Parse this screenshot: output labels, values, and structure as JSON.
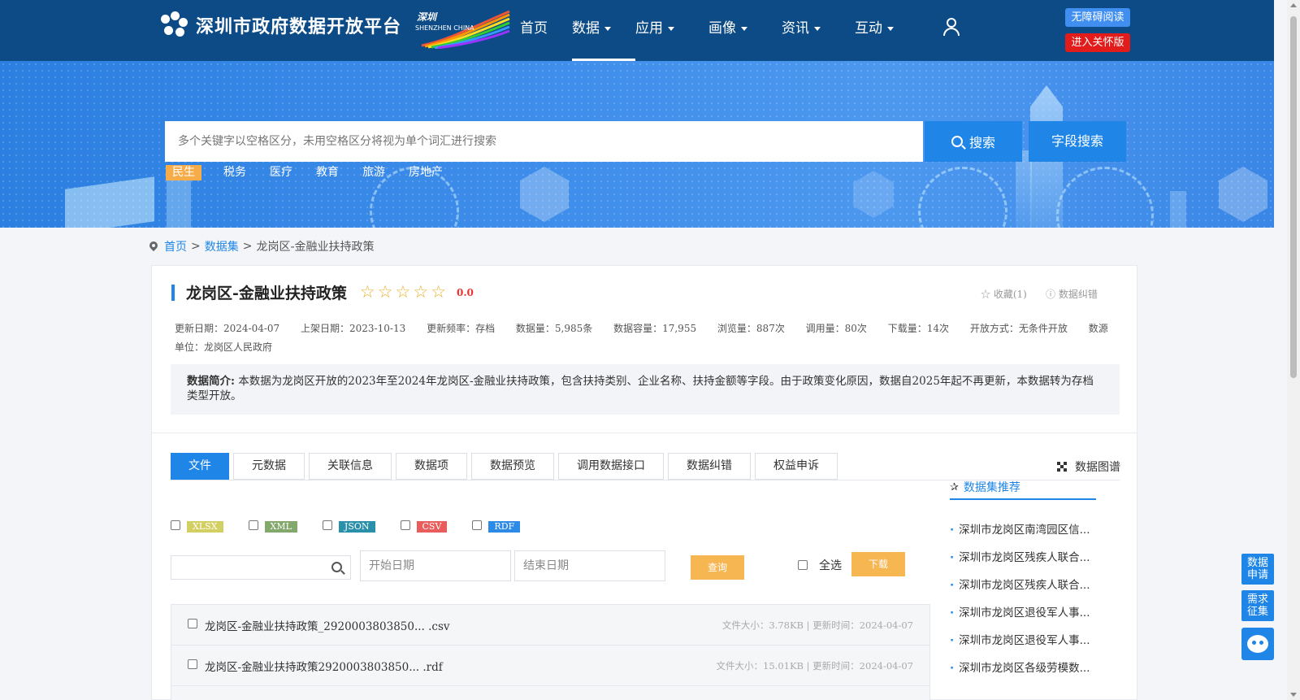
{
  "header": {
    "site_title": "深圳市政府数据开放平台",
    "badge_line1": "深圳",
    "badge_line2": "SHENZHEN CHINA",
    "nav": [
      {
        "label": "首页",
        "caret": false
      },
      {
        "label": "数据",
        "caret": true
      },
      {
        "label": "应用",
        "caret": true
      },
      {
        "label": "画像",
        "caret": true
      },
      {
        "label": "资讯",
        "caret": true
      },
      {
        "label": "互动",
        "caret": true
      }
    ],
    "accessibility_label": "无障碍阅读",
    "care_label": "进入关怀版"
  },
  "search": {
    "placeholder": "多个关键字以空格区分，未用空格区分将视为单个词汇进行搜索",
    "search_label": "搜索",
    "field_search_label": "字段搜索",
    "hot_tags": [
      "民生",
      "税务",
      "医疗",
      "教育",
      "旅游",
      "房地产"
    ]
  },
  "breadcrumb": {
    "home": "首页",
    "datasets": "数据集",
    "current": "龙岗区-金融业扶持政策",
    "sep": ">"
  },
  "dataset": {
    "title": "龙岗区-金融业扶持政策",
    "rating": "0.0",
    "stars": 5,
    "favorite": "收藏(1)",
    "correction": "数据纠错",
    "meta": [
      "更新日期：2024-04-07",
      "上架日期：2023-10-13",
      "更新频率：存档",
      "数据量：5,985条",
      "数据容量：17,955",
      "浏览量：887次",
      "调用量：80次",
      "下载量：14次",
      "开放方式：无条件开放",
      "数源单位：龙岗区人民政府"
    ],
    "intro_label": "数据简介:",
    "intro_text": " 本数据为龙岗区开放的2023年至2024年龙岗区-金融业扶持政策，包含扶持类别、企业名称、扶持金额等字段。由于政策变化原因，数据自2025年起不再更新，本数据转为存档类型开放。"
  },
  "tabs": [
    "文件",
    "元数据",
    "关联信息",
    "数据项",
    "数据预览",
    "调用数据接口",
    "数据纠错",
    "权益申诉"
  ],
  "graph_link": "数据图谱",
  "formats": [
    {
      "label": "XLSX",
      "color": "#d4cf62"
    },
    {
      "label": "XML",
      "color": "#83a86b"
    },
    {
      "label": "JSON",
      "color": "#2a8fa8"
    },
    {
      "label": "CSV",
      "color": "#ea5d5d"
    },
    {
      "label": "RDF",
      "color": "#2d8ae6"
    }
  ],
  "filters": {
    "start_date": "开始日期",
    "end_date": "结束日期",
    "query_label": "查询",
    "select_all": "全选",
    "download_label": "下载"
  },
  "files": [
    {
      "name": "龙岗区-金融业扶持政策_2920003803850... .csv",
      "info": "文件大小：3.78KB | 更新时间：2024-04-07"
    },
    {
      "name": "龙岗区-金融业扶持政策2920003803850... .rdf",
      "info": "文件大小：15.01KB | 更新时间：2024-04-07"
    },
    {
      "name": "",
      "info": ""
    }
  ],
  "recommend": {
    "title": "数据集推荐",
    "items": [
      "深圳市龙岗区南湾园区信...",
      "深圳市龙岗区残疾人联合...",
      "深圳市龙岗区残疾人联合...",
      "深圳市龙岗区退役军人事...",
      "深圳市龙岗区退役军人事...",
      "深圳市龙岗区各级劳模数..."
    ]
  },
  "floating": {
    "data_request": "数据申请",
    "demand_collect": "需求征集"
  }
}
